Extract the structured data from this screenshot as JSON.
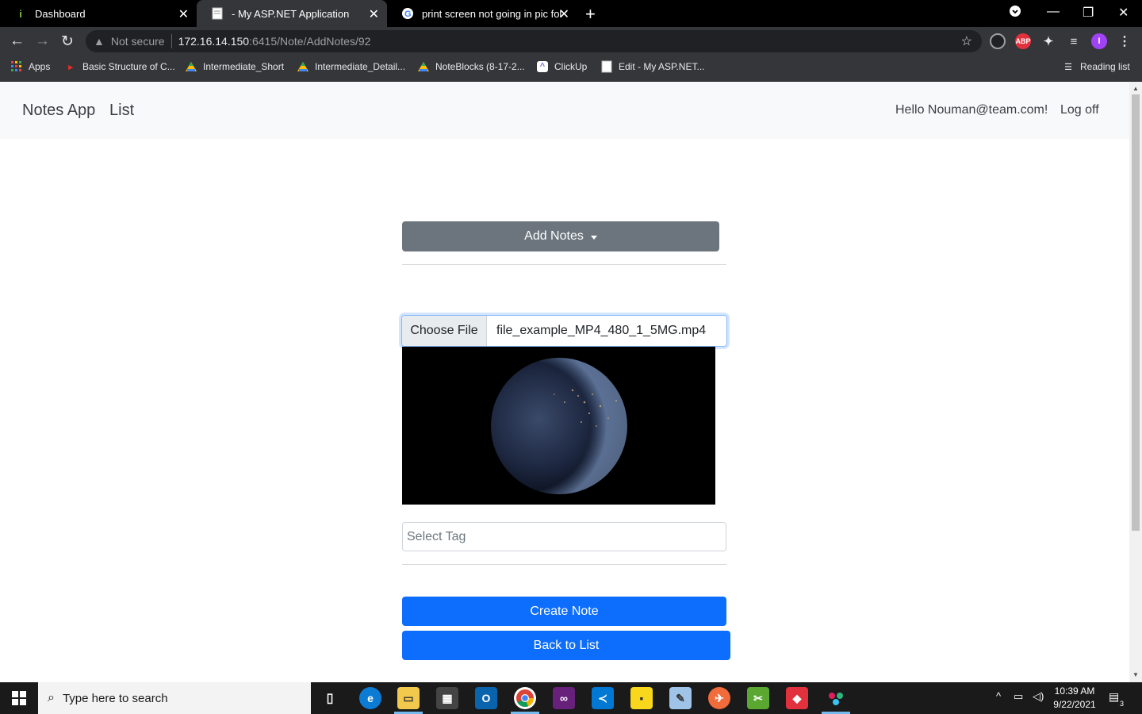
{
  "browser": {
    "tabs": [
      {
        "title": "Dashboard",
        "active": false
      },
      {
        "title": "- My ASP.NET Application",
        "active": true
      },
      {
        "title": "print screen not going in pic fold",
        "active": false
      }
    ],
    "security_label": "Not secure",
    "url_host": "172.16.14.150",
    "url_rest": ":6415/Note/AddNotes/92",
    "extensions": [
      {
        "label": "ABP",
        "color": "#e0313c"
      },
      {
        "label": "I",
        "color": "#a142f4"
      }
    ],
    "bookmarks": [
      "Apps",
      "Basic Structure of C...",
      "Intermediate_Short",
      "Intermediate_Detail...",
      "NoteBlocks (8-17-2...",
      "ClickUp",
      "Edit - My ASP.NET..."
    ],
    "reading_list": "Reading list"
  },
  "app": {
    "brand": "Notes App",
    "nav_list": "List",
    "greeting": "Hello Nouman@team.com!",
    "logoff": "Log off",
    "add_notes_label": "Add Notes",
    "choose_file_label": "Choose File",
    "file_name": "file_example_MP4_480_1_5MG.mp4",
    "tag_placeholder": "Select Tag",
    "create_label": "Create Note",
    "back_label": "Back to List"
  },
  "taskbar": {
    "search_placeholder": "Type here to search",
    "time": "10:39 AM",
    "date": "9/22/2021",
    "notification_count": "3"
  }
}
